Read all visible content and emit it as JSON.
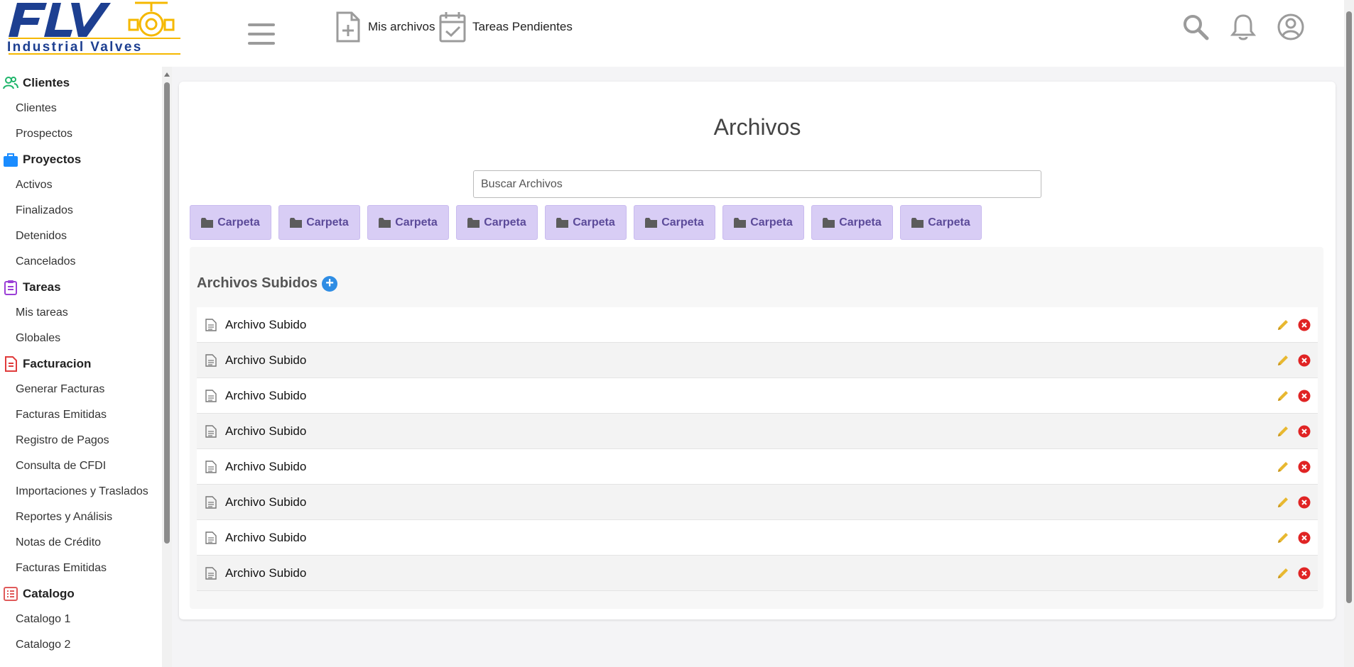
{
  "brand": {
    "logo_text": "Industrial Valves",
    "primary": "#1d3f91",
    "accent": "#f5b800"
  },
  "header": {
    "links": [
      {
        "label": "Mis archivos",
        "icon": "file-plus-icon"
      },
      {
        "label": "Tareas Pendientes",
        "icon": "calendar-check-icon"
      }
    ]
  },
  "sidebar": {
    "sections": [
      {
        "label": "Clientes",
        "icon": "users-icon",
        "color": "#1fb56b",
        "items": [
          "Clientes",
          "Prospectos"
        ]
      },
      {
        "label": "Proyectos",
        "icon": "briefcase-icon",
        "color": "#1a8cff",
        "items": [
          "Activos",
          "Finalizados",
          "Detenidos",
          "Cancelados"
        ]
      },
      {
        "label": "Tareas",
        "icon": "clipboard-icon",
        "color": "#9b3fd6",
        "items": [
          "Mis tareas",
          "Globales"
        ]
      },
      {
        "label": "Facturacion",
        "icon": "invoice-icon",
        "color": "#e03b3b",
        "items": [
          "Generar Facturas",
          "Facturas Emitidas",
          "Registro de Pagos",
          "Consulta de CFDI",
          "Importaciones y Traslados",
          "Reportes y Análisis",
          "Notas de Crédito",
          "Facturas Emitidas"
        ]
      },
      {
        "label": "Catalogo",
        "icon": "list-icon",
        "color": "#e05a5a",
        "items": [
          "Catalogo 1",
          "Catalogo 2"
        ]
      }
    ]
  },
  "main": {
    "title": "Archivos",
    "search_placeholder": "Buscar Archivos",
    "folders": [
      "Carpeta",
      "Carpeta",
      "Carpeta",
      "Carpeta",
      "Carpeta",
      "Carpeta",
      "Carpeta",
      "Carpeta",
      "Carpeta"
    ],
    "uploads_title": "Archivos Subidos",
    "files": [
      "Archivo Subido",
      "Archivo Subido",
      "Archivo Subido",
      "Archivo Subido",
      "Archivo Subido",
      "Archivo Subido",
      "Archivo Subido",
      "Archivo Subido"
    ]
  }
}
